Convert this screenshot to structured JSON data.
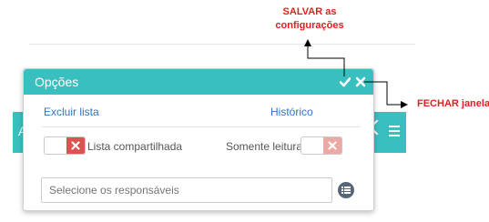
{
  "background_bar": {
    "letter": "A"
  },
  "dialog": {
    "title": "Opções",
    "links": {
      "exclude": "Excluir lista",
      "history": "Histórico"
    },
    "toggles": {
      "shared_label": "Lista compartilhada",
      "readonly_label": "Somente leitura"
    },
    "select": {
      "placeholder": "Selecione os responsáveis"
    }
  },
  "annotations": {
    "save_line1": "SALVAR as",
    "save_line2": "configurações",
    "close": "FECHAR janela"
  },
  "colors": {
    "accent": "#39bfbf",
    "link": "#2e74c7",
    "annotation": "#e02020",
    "toggle_off": "#d9534f"
  }
}
